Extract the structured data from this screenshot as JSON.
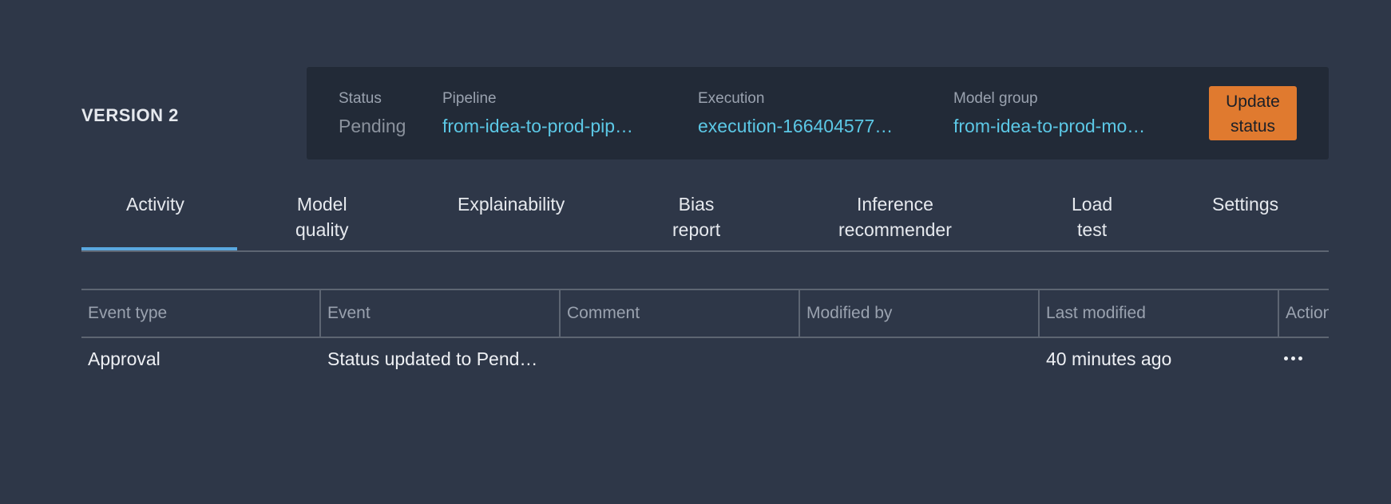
{
  "version_title": "VERSION 2",
  "info": {
    "status_label": "Status",
    "status_value": "Pending",
    "pipeline_label": "Pipeline",
    "pipeline_value": "from-idea-to-prod-pip…",
    "execution_label": "Execution",
    "execution_value": "execution-166404577…",
    "model_group_label": "Model group",
    "model_group_value": "from-idea-to-prod-mo…"
  },
  "update_button": {
    "line1": "Update",
    "line2": "status"
  },
  "tabs": [
    {
      "line1": "Activity",
      "line2": ""
    },
    {
      "line1": "Model",
      "line2": "quality"
    },
    {
      "line1": "Explainability",
      "line2": ""
    },
    {
      "line1": "Bias",
      "line2": "report"
    },
    {
      "line1": "Inference",
      "line2": "recommender"
    },
    {
      "line1": "Load",
      "line2": "test"
    },
    {
      "line1": "Settings",
      "line2": ""
    }
  ],
  "active_tab": "Activity",
  "table": {
    "headers": [
      "Event type",
      "Event",
      "Comment",
      "Modified by",
      "Last modified",
      "Actions"
    ],
    "rows": [
      {
        "event_type": "Approval",
        "event": "Status updated to Pend…",
        "comment": "",
        "modified_by": "",
        "last_modified": "40 minutes ago",
        "actions_icon": "more-horizontal-icon"
      }
    ]
  },
  "colors": {
    "background": "#2e3748",
    "panel": "#222a37",
    "link": "#5cc8e6",
    "accent_button": "#e07a2f",
    "tab_active_underline": "#5aa8e0"
  }
}
